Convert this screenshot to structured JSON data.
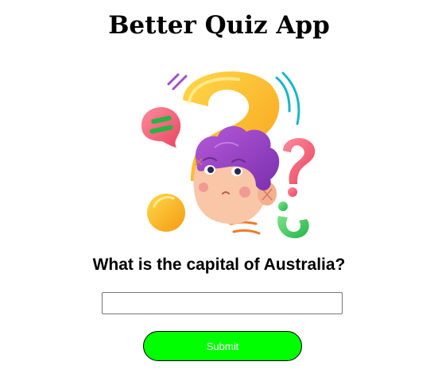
{
  "app": {
    "title": "Better Quiz App"
  },
  "illustration": {
    "icon": "confused-person-question-marks-illustration"
  },
  "quiz": {
    "question": "What is the capital of Australia?",
    "answer_value": "",
    "answer_placeholder": "",
    "submit_label": "Submit"
  },
  "colors": {
    "submit_background": "#00ff00",
    "submit_text": "#ffffff"
  }
}
